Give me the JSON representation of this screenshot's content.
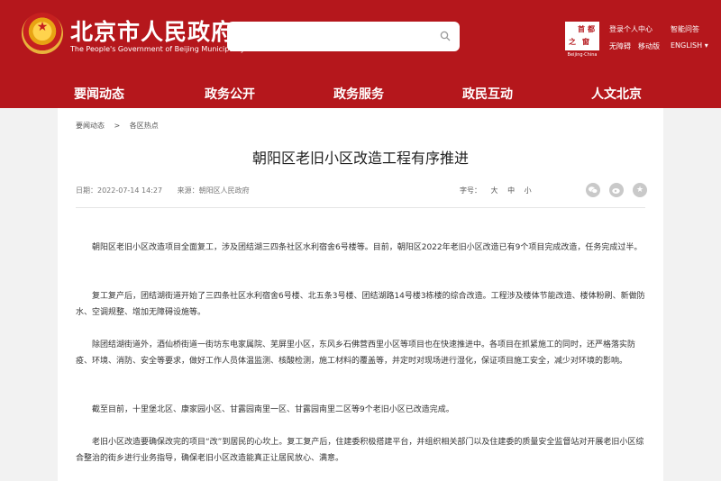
{
  "header": {
    "site_title": "北京市人民政府",
    "site_subtitle": "The People's Government of Beijing Municipality",
    "search_placeholder": "",
    "capital_logo_text": [
      "之",
      "首",
      "都",
      "窗"
    ],
    "capital_tag": "Beijing·China",
    "top_links": {
      "login": "登录个人中心",
      "smart_qa": "智能问答",
      "accessibility": "无障碍",
      "mobile": "移动版",
      "english": "ENGLISH ▾"
    },
    "nav": [
      "要闻动态",
      "政务公开",
      "政务服务",
      "政民互动",
      "人文北京"
    ]
  },
  "breadcrumb": [
    "要闻动态",
    ">",
    "各区热点"
  ],
  "article": {
    "title": "朝阳区老旧小区改造工程有序推进",
    "date": "日期：2022-07-14 14:27",
    "source": "来源：朝阳区人民政府",
    "fontsize_label": "字号：",
    "fontsize_options": [
      "大",
      "中",
      "小"
    ],
    "share_icons": [
      "wechat-icon",
      "weibo-icon",
      "favorite-icon"
    ],
    "paragraphs": [
      "朝阳区老旧小区改造项目全面复工，涉及团结湖三四条社区水利宿舍6号楼等。目前，朝阳区2022年老旧小区改造已有9个项目完成改造，任务完成过半。",
      "复工复产后，团结湖街道开始了三四条社区水利宿舍6号楼、北五条3号楼、团结湖路14号楼3栋楼的综合改造。工程涉及楼体节能改造、楼体粉刷、新做防水、空调规整、增加无障碍设施等。",
      "除团结湖街道外，酒仙桥街道一街坊东电家属院、芜屏里小区，东风乡石佛营西里小区等项目也在快速推进中。各项目在抓紧施工的同时，还严格落实防疫、环境、消防、安全等要求，做好工作人员体温监测、核酸检测，施工材料的覆盖等，并定时对现场进行湿化，保证项目施工安全，减少对环境的影响。",
      "截至目前，十里堡北区、康家园小区、甘露园南里一区、甘露园南里二区等9个老旧小区已改造完成。",
      "老旧小区改造要确保改完的项目“改”到居民的心坎上。复工复产后，住建委积极搭建平台，并组织相关部门以及住建委的质量安全监督站对开展老旧小区综合整治的街乡进行业务指导，确保老旧小区改造能真正让居民放心、满意。"
    ]
  },
  "colors": {
    "brand_red": "#b5171c",
    "page_bg": "#f2f2f2"
  }
}
